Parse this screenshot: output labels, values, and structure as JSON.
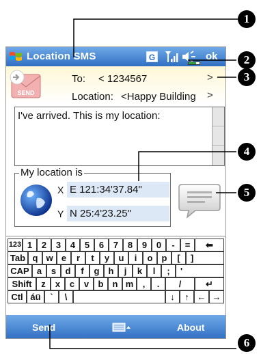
{
  "titlebar": {
    "title": "Location SMS",
    "g_badge": "G",
    "ok_label": "ok",
    "icons": [
      "windows-flag-icon",
      "signal-icon",
      "speaker-icon",
      "battery-icon"
    ]
  },
  "address": {
    "send_icon_label": "SEND",
    "to_label": "To:",
    "to_value": "< 1234567",
    "location_label": "Location:",
    "location_value": "<Happy Building",
    "arrow": ">"
  },
  "message": {
    "text": "I've arrived. This is my location:"
  },
  "my_location": {
    "group_title": "My location is",
    "x_label": "X",
    "x_value": "E 121:34'37.84\"",
    "y_label": "Y",
    "y_value": "N 25:4'23.25\""
  },
  "keyboard": {
    "rows": [
      [
        "123",
        "1",
        "2",
        "3",
        "4",
        "5",
        "6",
        "7",
        "8",
        "9",
        "0",
        "-",
        "=",
        "⬅"
      ],
      [
        "Tab",
        "q",
        "w",
        "e",
        "r",
        "t",
        "y",
        "u",
        "i",
        "o",
        "p",
        "[",
        "]"
      ],
      [
        "CAP",
        "a",
        "s",
        "d",
        "f",
        "g",
        "h",
        "j",
        "k",
        "l",
        ";",
        "'"
      ],
      [
        "Shift",
        "z",
        "x",
        "c",
        "v",
        "b",
        "n",
        "m",
        ",",
        ".",
        "/",
        "↵"
      ],
      [
        "Ctl",
        "áü",
        "`",
        "\\",
        "",
        "↓",
        "↑",
        "←",
        "→"
      ]
    ]
  },
  "bottombar": {
    "send_label": "Send",
    "about_label": "About"
  },
  "callouts": [
    "1",
    "2",
    "3",
    "4",
    "5",
    "6"
  ],
  "colors": {
    "bar_blue": "#2f6fc3",
    "field_blue": "#dde8f7",
    "address_bg": "#fff7d6"
  }
}
